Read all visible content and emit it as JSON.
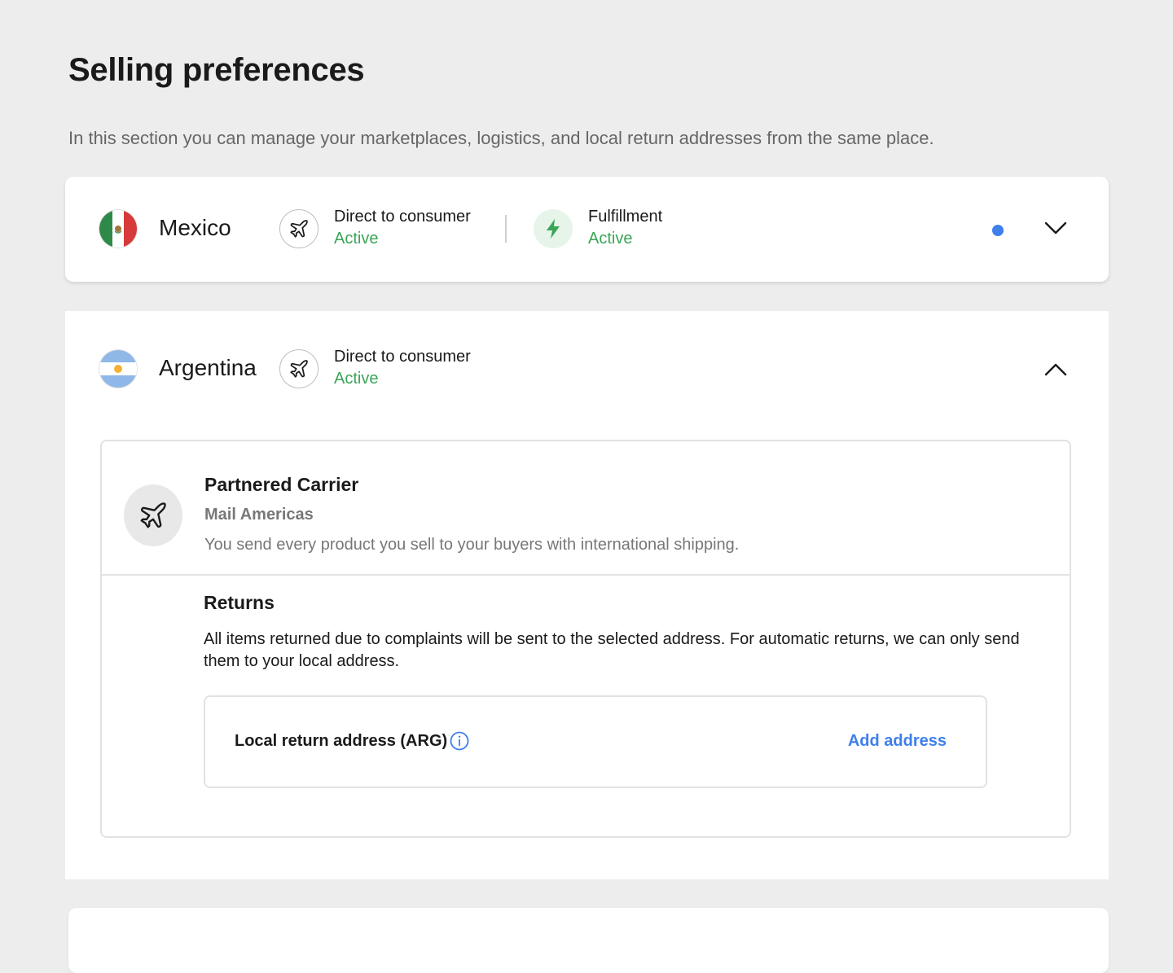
{
  "header": {
    "title": "Selling preferences",
    "subtitle": "In this section you can manage your marketplaces, logistics, and local return addresses from the same place."
  },
  "colors": {
    "active_green": "#39a556",
    "accent_blue": "#3f7fec",
    "background": "#ededed"
  },
  "countries": [
    {
      "name": "Mexico",
      "flag": "mexico-flag",
      "expanded": false,
      "has_notification_dot": true,
      "modes": [
        {
          "label": "Direct to consumer",
          "status": "Active",
          "icon": "airplane-icon"
        },
        {
          "label": "Fulfillment",
          "status": "Active",
          "icon": "lightning-icon"
        }
      ]
    },
    {
      "name": "Argentina",
      "flag": "argentina-flag",
      "expanded": true,
      "modes": [
        {
          "label": "Direct to consumer",
          "status": "Active",
          "icon": "airplane-icon"
        }
      ],
      "details": {
        "carrier_title": "Partnered Carrier",
        "carrier_name": "Mail Americas",
        "carrier_description": "You send every product you sell to your buyers with international shipping.",
        "returns_title": "Returns",
        "returns_description": "All items returned due to complaints will be sent to the selected address. For automatic returns, we can only send them to your local address.",
        "address_label": "Local return address (ARG)",
        "add_address_label": "Add address"
      }
    }
  ]
}
